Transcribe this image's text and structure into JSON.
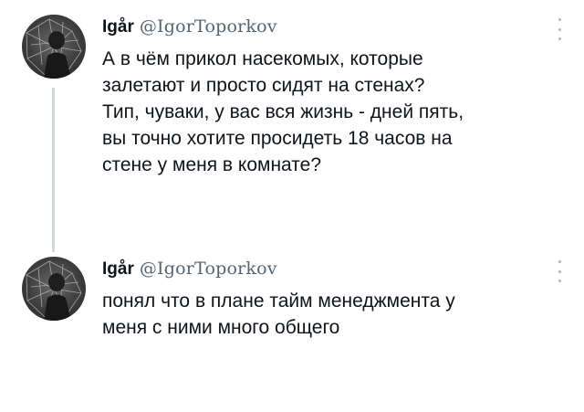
{
  "tweets": [
    {
      "author_name": "Igår",
      "author_handle": "@IgorToporkov",
      "lines": [
        "А в чём прикол насекомых, которые",
        "залетают и просто сидят на стенах?",
        "Тип, чуваки, у вас вся жизнь - дней пять,",
        "вы точно хотите просидеть 18 часов на",
        "стене у меня в комнате?"
      ],
      "avatar_icon": "profile-photo",
      "menu_icon": "more-vertical-icon"
    },
    {
      "author_name": "Igår",
      "author_handle": "@IgorToporkov",
      "lines": [
        "понял что в плане тайм менеджмента у",
        "меня с ними много общего"
      ],
      "avatar_icon": "profile-photo",
      "menu_icon": "more-vertical-icon"
    }
  ],
  "colors": {
    "text": "#0f1419",
    "handle": "#536471",
    "thread_line": "#cfd9de",
    "menu_dots": "#aab8c2"
  }
}
